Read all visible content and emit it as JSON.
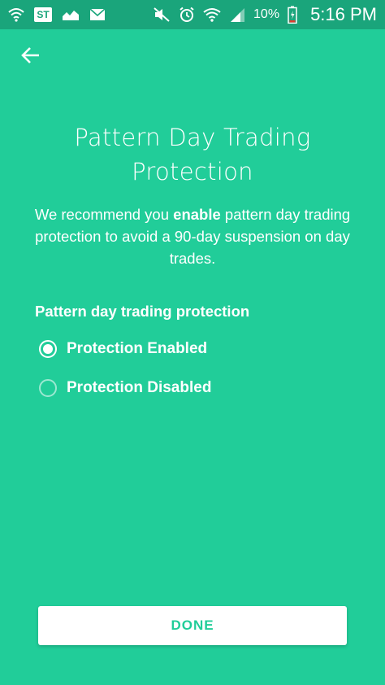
{
  "status_bar": {
    "notification_icons": [
      "wifi-notification-icon",
      "stocktwits-icon",
      "chart-icon",
      "email-icon"
    ],
    "st_badge": "ST",
    "system_icons": [
      "mute-icon",
      "alarm-icon",
      "wifi-icon",
      "signal-icon",
      "battery-icon"
    ],
    "battery_percent": "10%",
    "time": "5:16 PM"
  },
  "header": {
    "back_icon": "arrow-left-icon"
  },
  "main": {
    "title_line1": "Pattern Day Trading",
    "title_line2": "Protection",
    "description_part1": "We recommend you ",
    "description_bold": "enable",
    "description_part2": " pattern day trading protection to avoid a 90-day suspension on day trades.",
    "section_label": "Pattern day trading protection",
    "options": [
      {
        "label": "Protection Enabled",
        "selected": true
      },
      {
        "label": "Protection Disabled",
        "selected": false
      }
    ]
  },
  "footer": {
    "done_label": "DONE"
  },
  "colors": {
    "background": "#21cd99",
    "status_bar": "#1aa57b",
    "text": "#ffffff",
    "button_bg": "#ffffff",
    "button_text": "#21cd99"
  }
}
